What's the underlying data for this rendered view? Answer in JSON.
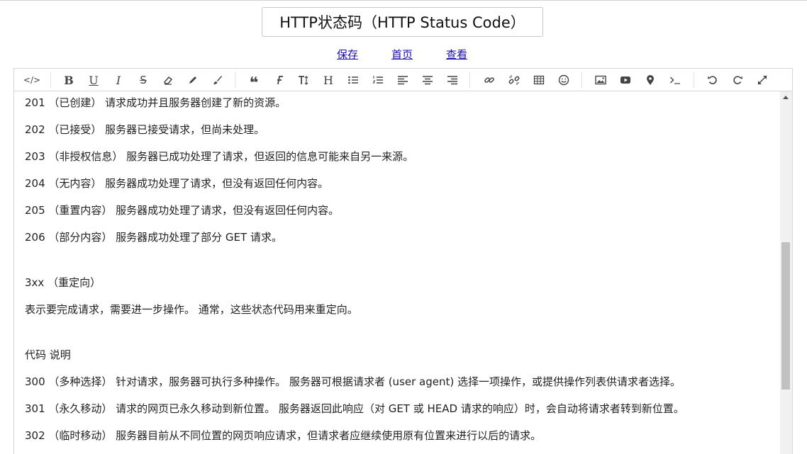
{
  "title": "HTTP状态码（HTTP Status Code）",
  "links": {
    "save": "保存",
    "home": "首页",
    "view": "查看"
  },
  "toolbar": {
    "code": "</>",
    "bold": "B",
    "underline": "U",
    "italic": "I",
    "strike": "S",
    "quote": "❝",
    "heading": "H"
  },
  "lines": [
    "201 （已创建） 请求成功并且服务器创建了新的资源。",
    "202 （已接受） 服务器已接受请求，但尚未处理。",
    "203 （非授权信息） 服务器已成功处理了请求，但返回的信息可能来自另一来源。",
    "204 （无内容） 服务器成功处理了请求，但没有返回任何内容。",
    "205 （重置内容） 服务器成功处理了请求，但没有返回任何内容。",
    "206 （部分内容） 服务器成功处理了部分 GET 请求。",
    "3xx （重定向）",
    "表示要完成请求，需要进一步操作。 通常，这些状态代码用来重定向。",
    "代码 说明",
    "300 （多种选择） 针对请求，服务器可执行多种操作。 服务器可根据请求者 (user agent) 选择一项操作，或提供操作列表供请求者选择。",
    "301 （永久移动） 请求的网页已永久移动到新位置。 服务器返回此响应（对 GET 或 HEAD 请求的响应）时，会自动将请求者转到新位置。",
    "302 （临时移动） 服务器目前从不同位置的网页响应请求，但请求者应继续使用原有位置来进行以后的请求。"
  ]
}
